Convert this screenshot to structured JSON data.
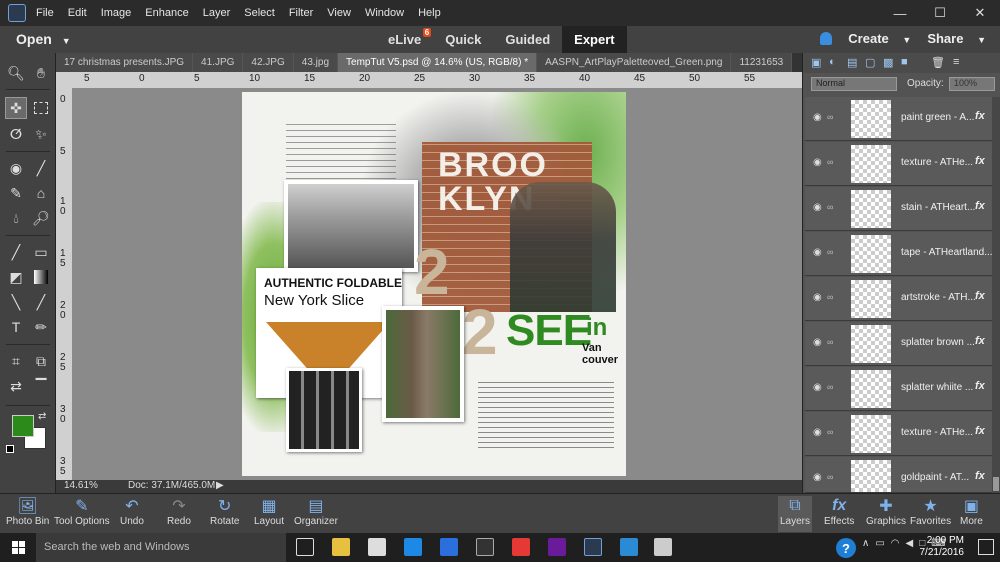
{
  "menu": {
    "items": [
      "File",
      "Edit",
      "Image",
      "Enhance",
      "Layer",
      "Select",
      "Filter",
      "View",
      "Window",
      "Help"
    ]
  },
  "modebar": {
    "open_label": "Open",
    "modes": [
      {
        "label": "eLive",
        "badge": "6"
      },
      {
        "label": "Quick"
      },
      {
        "label": "Guided"
      },
      {
        "label": "Expert",
        "active": true
      }
    ],
    "create_label": "Create",
    "share_label": "Share"
  },
  "tabs": [
    {
      "label": "17 christmas presents.JPG"
    },
    {
      "label": "41.JPG"
    },
    {
      "label": "42.JPG"
    },
    {
      "label": "43.jpg"
    },
    {
      "label": "TempTut V5.psd @ 14.6% (US, RGB/8) *",
      "active": true
    },
    {
      "label": "AASPN_ArtPlayPaletteoved_Green.png"
    },
    {
      "label": "11231653"
    }
  ],
  "ruler_top": [
    "5",
    "0",
    "5",
    "10",
    "15",
    "20",
    "25",
    "30",
    "35",
    "40",
    "45",
    "50",
    "55"
  ],
  "ruler_left": [
    "0",
    "5",
    "1",
    "0",
    "1",
    "5",
    "2",
    "0",
    "2",
    "5",
    "3",
    "0",
    "3",
    "5"
  ],
  "status": {
    "zoom": "14.61%",
    "doc": "Doc: 37.1M/465.0M"
  },
  "artwork": {
    "brooklyn_line1": "BROO",
    "brooklyn_line2": "KLYN",
    "foldable": "AUTHENTIC FOLDABLE",
    "slice": "New York Slice",
    "see": "SEE",
    "in": "in",
    "van": "Van",
    "couver": "couver"
  },
  "layers_panel": {
    "blend_mode": "Normal",
    "opacity_label": "Opacity:",
    "opacity_value": "100%",
    "layers": [
      {
        "name": "paint green - A...",
        "fx": "fx"
      },
      {
        "name": "texture - ATHe...",
        "fx": "fx"
      },
      {
        "name": "stain - ATHeart...",
        "fx": "fx"
      },
      {
        "name": "tape - ATHeartland...",
        "fx": ""
      },
      {
        "name": "artstroke - ATH...",
        "fx": "fx"
      },
      {
        "name": "splatter brown ...",
        "fx": "fx"
      },
      {
        "name": "splatter whiite ...",
        "fx": "fx"
      },
      {
        "name": "texture - ATHe...",
        "fx": "fx"
      },
      {
        "name": "goldpaint - AT...",
        "fx": "fx"
      }
    ]
  },
  "bottombar": {
    "left": [
      {
        "label": "Photo Bin",
        "icon": "photo-bin-icon"
      },
      {
        "label": "Tool Options",
        "icon": "tool-options-icon"
      },
      {
        "label": "Undo",
        "icon": "undo-icon"
      },
      {
        "label": "Redo",
        "icon": "redo-icon"
      },
      {
        "label": "Rotate",
        "icon": "rotate-icon"
      },
      {
        "label": "Layout",
        "icon": "layout-icon"
      },
      {
        "label": "Organizer",
        "icon": "organizer-icon"
      }
    ],
    "right": [
      {
        "label": "Layers",
        "icon": "layers-icon"
      },
      {
        "label": "Effects",
        "icon": "effects-icon"
      },
      {
        "label": "Graphics",
        "icon": "graphics-icon"
      },
      {
        "label": "Favorites",
        "icon": "favorites-icon"
      },
      {
        "label": "More",
        "icon": "more-icon"
      }
    ]
  },
  "taskbar": {
    "search_placeholder": "Search the web and Windows",
    "time": "2:00 PM",
    "date": "7/21/2016"
  },
  "colors": {
    "accent": "#3b8de0",
    "foreground_swatch": "#2c8a1a",
    "background_swatch": "#ffffff"
  }
}
